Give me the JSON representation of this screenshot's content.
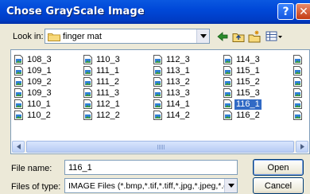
{
  "window": {
    "title": "Chose GrayScale Image",
    "help_glyph": "?",
    "close_glyph": "✕"
  },
  "look_in": {
    "label": "Look in:",
    "value": "finger mat",
    "icons": [
      "folder-icon",
      "back-arrow-icon",
      "up-folder-icon",
      "new-folder-icon",
      "view-menu-icon"
    ]
  },
  "files": [
    [
      "108_3",
      "109_1",
      "109_2",
      "109_3",
      "110_1",
      "110_2"
    ],
    [
      "110_3",
      "111_1",
      "111_2",
      "111_3",
      "112_1",
      "112_2"
    ],
    [
      "112_3",
      "113_1",
      "113_2",
      "113_3",
      "114_1",
      "114_2"
    ],
    [
      "114_3",
      "115_1",
      "115_2",
      "115_3",
      "116_1",
      "116_2"
    ]
  ],
  "selected_file": "116_1",
  "file_name": {
    "label": "File name:",
    "value": "116_1"
  },
  "file_type": {
    "label": "Files of type:",
    "value": "IMAGE Files (*.bmp,*.tif,*.tiff,*.jpg,*.jpeg,*.gif)"
  },
  "buttons": {
    "open": "Open",
    "cancel": "Cancel"
  },
  "colors": {
    "title_bar": "#0048d8",
    "selection": "#316ac5",
    "dialog_bg": "#ece9d8"
  }
}
